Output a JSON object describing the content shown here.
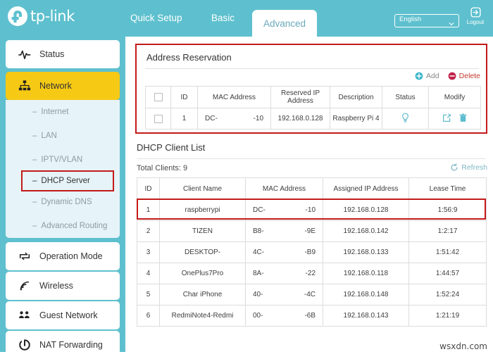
{
  "header": {
    "brand": "tp-link",
    "brand_icon": "tp-link-logo-icon",
    "tabs": [
      {
        "label": "Quick Setup",
        "active": false
      },
      {
        "label": "Basic",
        "active": false
      },
      {
        "label": "Advanced",
        "active": true
      }
    ],
    "language": {
      "value": "English",
      "icon": "chevron-down-icon"
    },
    "logout": {
      "label": "Logout",
      "icon": "logout-icon"
    }
  },
  "sidebar": {
    "items": [
      {
        "label": "Status",
        "icon": "activity-pulse-icon",
        "active": false
      },
      {
        "label": "Network",
        "icon": "network-tree-icon",
        "active": true
      },
      {
        "label": "Operation Mode",
        "icon": "operation-mode-icon",
        "active": false
      },
      {
        "label": "Wireless",
        "icon": "wireless-signal-icon",
        "active": false
      },
      {
        "label": "Guest Network",
        "icon": "guest-users-icon",
        "active": false
      },
      {
        "label": "NAT Forwarding",
        "icon": "nat-forwarding-icon",
        "active": false
      }
    ],
    "submenu": [
      {
        "label": "Internet",
        "selected": false
      },
      {
        "label": "LAN",
        "selected": false
      },
      {
        "label": "IPTV/VLAN",
        "selected": false
      },
      {
        "label": "DHCP Server",
        "selected": true
      },
      {
        "label": "Dynamic DNS",
        "selected": false
      },
      {
        "label": "Advanced Routing",
        "selected": false
      }
    ],
    "submenu_dash": "–"
  },
  "address_reservation": {
    "title": "Address Reservation",
    "actions": [
      {
        "label": "Add",
        "icon": "plus-circle-icon"
      },
      {
        "label": "Delete",
        "icon": "minus-circle-icon"
      }
    ],
    "columns": [
      "",
      "ID",
      "MAC Address",
      "Reserved IP Address",
      "Description",
      "Status",
      "Modify"
    ],
    "rows": [
      {
        "id": "1",
        "mac_prefix": "DC-",
        "mac_suffix": "-10",
        "reserved_ip": "192.168.0.128",
        "description": "Raspberry Pi 4",
        "status_icon": "lightbulb-icon",
        "modify_icons": [
          "edit-icon",
          "trash-icon"
        ]
      }
    ]
  },
  "dhcp_client_list": {
    "title": "DHCP Client List",
    "total_clients_label": "Total Clients: 9",
    "refresh": {
      "label": "Refresh",
      "icon": "refresh-icon"
    },
    "columns": [
      "ID",
      "Client Name",
      "MAC Address",
      "Assigned IP Address",
      "Lease Time"
    ],
    "rows": [
      {
        "id": "1",
        "name": "raspberrypi",
        "mac_prefix": "DC-",
        "mac_suffix": "-10",
        "ip": "192.168.0.128",
        "lease": "1:56:9"
      },
      {
        "id": "2",
        "name": "TIZEN",
        "mac_prefix": "B8-",
        "mac_suffix": "-9E",
        "ip": "192.168.0.142",
        "lease": "1:2:17"
      },
      {
        "id": "3",
        "name": "DESKTOP-",
        "mac_prefix": "4C-",
        "mac_suffix": "-B9",
        "ip": "192.168.0.133",
        "lease": "1:51:42"
      },
      {
        "id": "4",
        "name": "OnePlus7Pro",
        "mac_prefix": "8A-",
        "mac_suffix": "-22",
        "ip": "192.168.0.118",
        "lease": "1:44:57"
      },
      {
        "id": "5",
        "name": "Char      iPhone",
        "mac_prefix": "40-",
        "mac_suffix": "-4C",
        "ip": "192.168.0.148",
        "lease": "1:52:24"
      },
      {
        "id": "6",
        "name": "RedmiNote4-Redmi",
        "mac_prefix": "00-",
        "mac_suffix": "-6B",
        "ip": "192.168.0.143",
        "lease": "1:21:19"
      }
    ]
  },
  "watermark": "wsxdn.com",
  "colors": {
    "teal": "#5ec0ce",
    "yellow": "#f6c915",
    "highlight_red": "#c31a1a",
    "submenu_bg": "#e6f3f8",
    "delete_red": "#c0392b"
  }
}
